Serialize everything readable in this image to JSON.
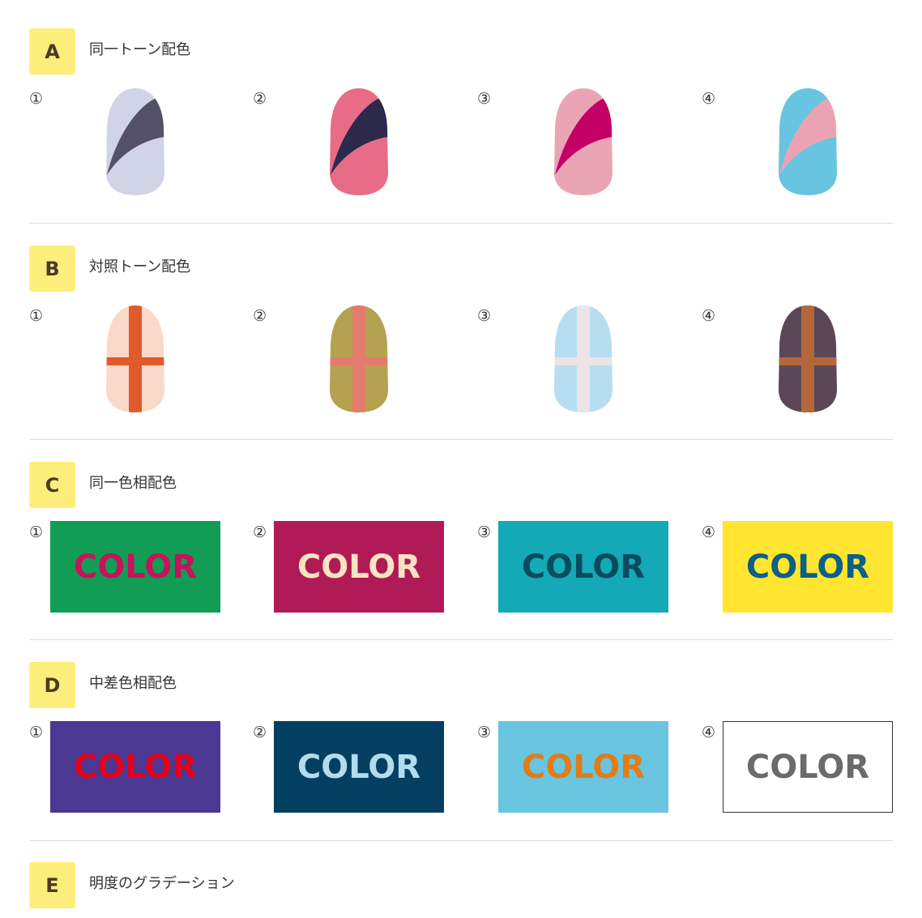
{
  "sections": [
    {
      "letter": "A",
      "title": "同一トーン配色",
      "type": "nail-diagonal",
      "items": [
        {
          "num": "①",
          "base": "#d1d4e6",
          "accent": "#545065"
        },
        {
          "num": "②",
          "base": "#e86c87",
          "accent": "#2b2a4d"
        },
        {
          "num": "③",
          "base": "#eaa5b5",
          "accent": "#c40066"
        },
        {
          "num": "④",
          "base": "#67c5e1",
          "accent": "#eba3b4"
        }
      ]
    },
    {
      "letter": "B",
      "title": "対照トーン配色",
      "type": "nail-cross",
      "items": [
        {
          "num": "①",
          "base": "#fad9c8",
          "accent": "#e15a2b"
        },
        {
          "num": "②",
          "base": "#b4a250",
          "accent": "#e37c6e"
        },
        {
          "num": "③",
          "base": "#b7def0",
          "accent": "#ece3e7"
        },
        {
          "num": "④",
          "base": "#5b4756",
          "accent": "#b4673b"
        }
      ]
    },
    {
      "letter": "C",
      "title": "同一色相配色",
      "type": "swatch",
      "items": [
        {
          "num": "①",
          "bg": "#119d55",
          "fg": "#c8125b",
          "text": "COLOR",
          "border": ""
        },
        {
          "num": "②",
          "bg": "#b01b57",
          "fg": "#fbe3c1",
          "text": "COLOR",
          "border": ""
        },
        {
          "num": "③",
          "bg": "#13a9b7",
          "fg": "#0a4b5e",
          "text": "COLOR",
          "border": ""
        },
        {
          "num": "④",
          "bg": "#ffe52f",
          "fg": "#0c5f87",
          "text": "COLOR",
          "border": ""
        }
      ]
    },
    {
      "letter": "D",
      "title": "中差色相配色",
      "type": "swatch",
      "items": [
        {
          "num": "①",
          "bg": "#4a3893",
          "fg": "#e2001b",
          "text": "COLOR",
          "border": ""
        },
        {
          "num": "②",
          "bg": "#043e60",
          "fg": "#b2dcef",
          "text": "COLOR",
          "border": ""
        },
        {
          "num": "③",
          "bg": "#6ac5e1",
          "fg": "#e07d17",
          "text": "COLOR",
          "border": ""
        },
        {
          "num": "④",
          "bg": "#ffffff",
          "fg": "#6b6b6b",
          "text": "COLOR",
          "border": "#333333"
        }
      ]
    },
    {
      "letter": "E",
      "title": "明度のグラデーション",
      "type": "none",
      "items": []
    }
  ]
}
